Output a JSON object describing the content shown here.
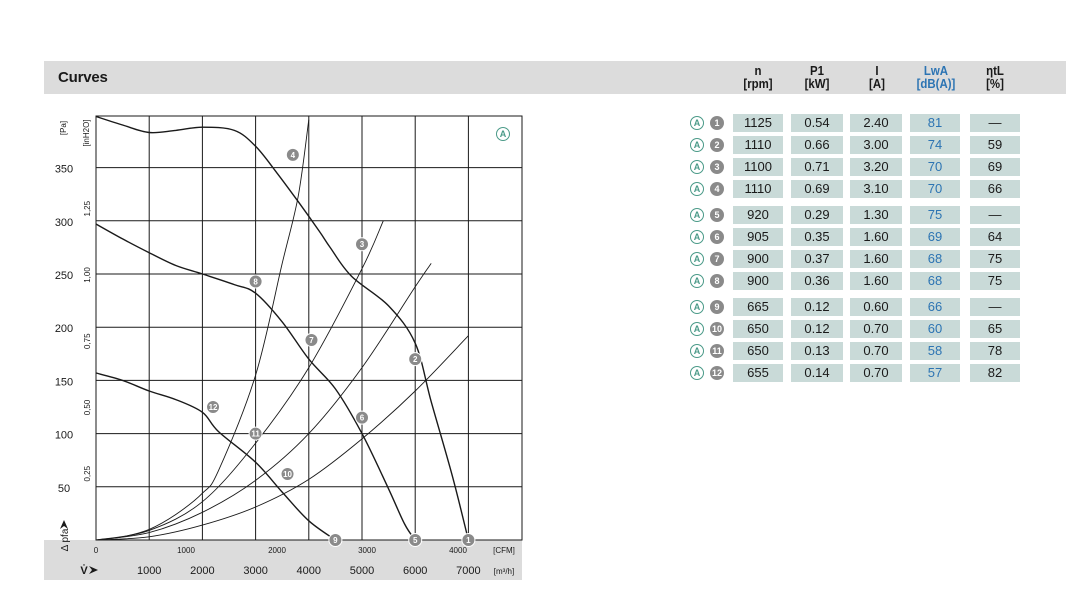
{
  "header": {
    "title": "Curves",
    "columns": [
      {
        "top": "n",
        "unit": "[rpm]",
        "blue": false
      },
      {
        "top": "P1",
        "unit": "[kW]",
        "blue": false
      },
      {
        "top": "I",
        "unit": "[A]",
        "blue": false
      },
      {
        "top": "LwA",
        "unit": "[dB(A)]",
        "blue": true
      },
      {
        "top": "ηtL",
        "unit": "[%]",
        "blue": false
      }
    ]
  },
  "table": {
    "rows": [
      {
        "curve": "A",
        "point": "1",
        "n": "1125",
        "p1": "0.54",
        "i": "2.40",
        "lwa": "81",
        "eta": "—"
      },
      {
        "curve": "A",
        "point": "2",
        "n": "1110",
        "p1": "0.66",
        "i": "3.00",
        "lwa": "74",
        "eta": "59"
      },
      {
        "curve": "A",
        "point": "3",
        "n": "1100",
        "p1": "0.71",
        "i": "3.20",
        "lwa": "70",
        "eta": "69"
      },
      {
        "curve": "A",
        "point": "4",
        "n": "1110",
        "p1": "0.69",
        "i": "3.10",
        "lwa": "70",
        "eta": "66"
      },
      {
        "curve": "A",
        "point": "5",
        "n": "920",
        "p1": "0.29",
        "i": "1.30",
        "lwa": "75",
        "eta": "—"
      },
      {
        "curve": "A",
        "point": "6",
        "n": "905",
        "p1": "0.35",
        "i": "1.60",
        "lwa": "69",
        "eta": "64"
      },
      {
        "curve": "A",
        "point": "7",
        "n": "900",
        "p1": "0.37",
        "i": "1.60",
        "lwa": "68",
        "eta": "75"
      },
      {
        "curve": "A",
        "point": "8",
        "n": "900",
        "p1": "0.36",
        "i": "1.60",
        "lwa": "68",
        "eta": "75"
      },
      {
        "curve": "A",
        "point": "9",
        "n": "665",
        "p1": "0.12",
        "i": "0.60",
        "lwa": "66",
        "eta": "—"
      },
      {
        "curve": "A",
        "point": "10",
        "n": "650",
        "p1": "0.12",
        "i": "0.70",
        "lwa": "60",
        "eta": "65"
      },
      {
        "curve": "A",
        "point": "11",
        "n": "650",
        "p1": "0.13",
        "i": "0.70",
        "lwa": "58",
        "eta": "78"
      },
      {
        "curve": "A",
        "point": "12",
        "n": "655",
        "p1": "0.14",
        "i": "0.70",
        "lwa": "57",
        "eta": "82"
      }
    ]
  },
  "chart_data": {
    "type": "line",
    "curve_label": "A",
    "ylabel_pa": "[Pa]",
    "ylabel_inh2o": "[inH2O]",
    "ylabel_axis": "Δ pfa",
    "xlabel_cfm": "[CFM]",
    "xlabel_m3h": "[m³/h]",
    "xlabel_axis": "V̇",
    "y_ticks_pa": [
      50,
      100,
      150,
      200,
      250,
      300,
      350
    ],
    "y_ticks_inh2o": [
      "0,25",
      "0,50",
      "0,75",
      "1,00",
      "1,25"
    ],
    "x_ticks_cfm": [
      "0",
      "1000",
      "2000",
      "3000",
      "4000"
    ],
    "x_ticks_m3h": [
      "1000",
      "2000",
      "3000",
      "4000",
      "5000",
      "6000",
      "7000"
    ],
    "xlim_m3h": [
      0,
      8000
    ],
    "ylim_pa": [
      0,
      400
    ],
    "series": [
      {
        "id": "fan-curve-high",
        "x": [
          0,
          500,
          1000,
          1500,
          2000,
          2600,
          3000,
          3400,
          3800,
          4200,
          4400,
          4800,
          5500,
          6000,
          6300,
          6700,
          7000
        ],
        "y": [
          398,
          390,
          383,
          385,
          388,
          385,
          370,
          345,
          318,
          290,
          275,
          248,
          220,
          185,
          130,
          60,
          0
        ]
      },
      {
        "id": "fan-curve-mid",
        "x": [
          0,
          500,
          1000,
          1500,
          2000,
          2600,
          3000,
          3500,
          4000,
          4500,
          5000,
          5500,
          5800,
          6000
        ],
        "y": [
          297,
          283,
          270,
          258,
          250,
          240,
          232,
          205,
          170,
          142,
          100,
          48,
          15,
          0
        ]
      },
      {
        "id": "fan-curve-low",
        "x": [
          0,
          500,
          1000,
          1500,
          2000,
          2300,
          3000,
          3500,
          4000,
          4500
        ],
        "y": [
          157,
          150,
          140,
          132,
          120,
          102,
          73,
          45,
          18,
          0
        ]
      },
      {
        "id": "system-line-steep",
        "x": [
          0,
          500,
          1000,
          1500,
          2000,
          2300,
          3000,
          3500,
          3800,
          4000
        ],
        "y": [
          0,
          3,
          10,
          24,
          44,
          65,
          155,
          260,
          323,
          395
        ]
      },
      {
        "id": "system-line-a",
        "x": [
          0,
          1000,
          2000,
          3000,
          4000,
          5000,
          5400
        ],
        "y": [
          0,
          9,
          36,
          91,
          162,
          255,
          300
        ]
      },
      {
        "id": "system-line-b",
        "x": [
          0,
          1000,
          2000,
          3000,
          4000,
          5000,
          6000,
          6300
        ],
        "y": [
          0,
          7,
          26,
          56,
          100,
          162,
          238,
          260
        ]
      },
      {
        "id": "system-line-c",
        "x": [
          0,
          1000,
          2000,
          3000,
          4000,
          5000,
          6000,
          7000
        ],
        "y": [
          0,
          3,
          14,
          31,
          57,
          95,
          140,
          192
        ]
      }
    ],
    "points": [
      {
        "label": "1",
        "x": 7000,
        "y": 0
      },
      {
        "label": "2",
        "x": 6000,
        "y": 170
      },
      {
        "label": "3",
        "x": 5000,
        "y": 278
      },
      {
        "label": "4",
        "x": 3700,
        "y": 362
      },
      {
        "label": "5",
        "x": 6000,
        "y": 0
      },
      {
        "label": "6",
        "x": 5000,
        "y": 115
      },
      {
        "label": "7",
        "x": 4050,
        "y": 188
      },
      {
        "label": "8",
        "x": 3000,
        "y": 243
      },
      {
        "label": "9",
        "x": 4500,
        "y": 0
      },
      {
        "label": "10",
        "x": 3600,
        "y": 62
      },
      {
        "label": "11",
        "x": 3000,
        "y": 100
      },
      {
        "label": "12",
        "x": 2200,
        "y": 125
      }
    ]
  }
}
